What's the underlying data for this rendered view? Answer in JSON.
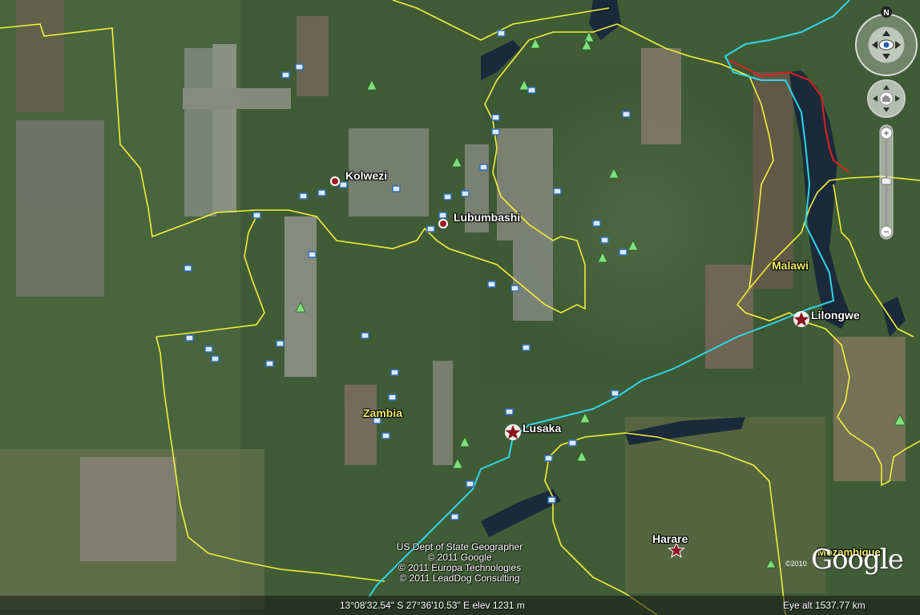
{
  "cities": [
    {
      "name": "Kolwezi",
      "type": "dot"
    },
    {
      "name": "Lubumbashi",
      "type": "dot"
    },
    {
      "name": "Lusaka",
      "type": "capital"
    },
    {
      "name": "Lilongwe",
      "type": "capital"
    },
    {
      "name": "Harare",
      "type": "capital"
    }
  ],
  "countries": [
    "Zambia",
    "Malawi",
    "Mozambique"
  ],
  "attribution": [
    "US Dept of State Geographer",
    "© 2011 Google",
    "© 2011 Europa Technologies",
    "© 2011 LeadDog Consulting"
  ],
  "status": {
    "coordinates": "13°08'32.54\" S   27°36'10.53\" E  elev  1231 m",
    "eye_alt": "Eye alt   1537.77 km"
  },
  "logo": {
    "text": "Google",
    "copyright": "©2010"
  },
  "controls": {
    "north_label": "N",
    "zoom_in": "+",
    "zoom_out": "−"
  },
  "colors": {
    "border": "#f2ee3a",
    "route": "#2fd6e8",
    "lake_border": "#e02020",
    "capital_star": "#8b1520",
    "park_icon": "#7ee07a"
  }
}
